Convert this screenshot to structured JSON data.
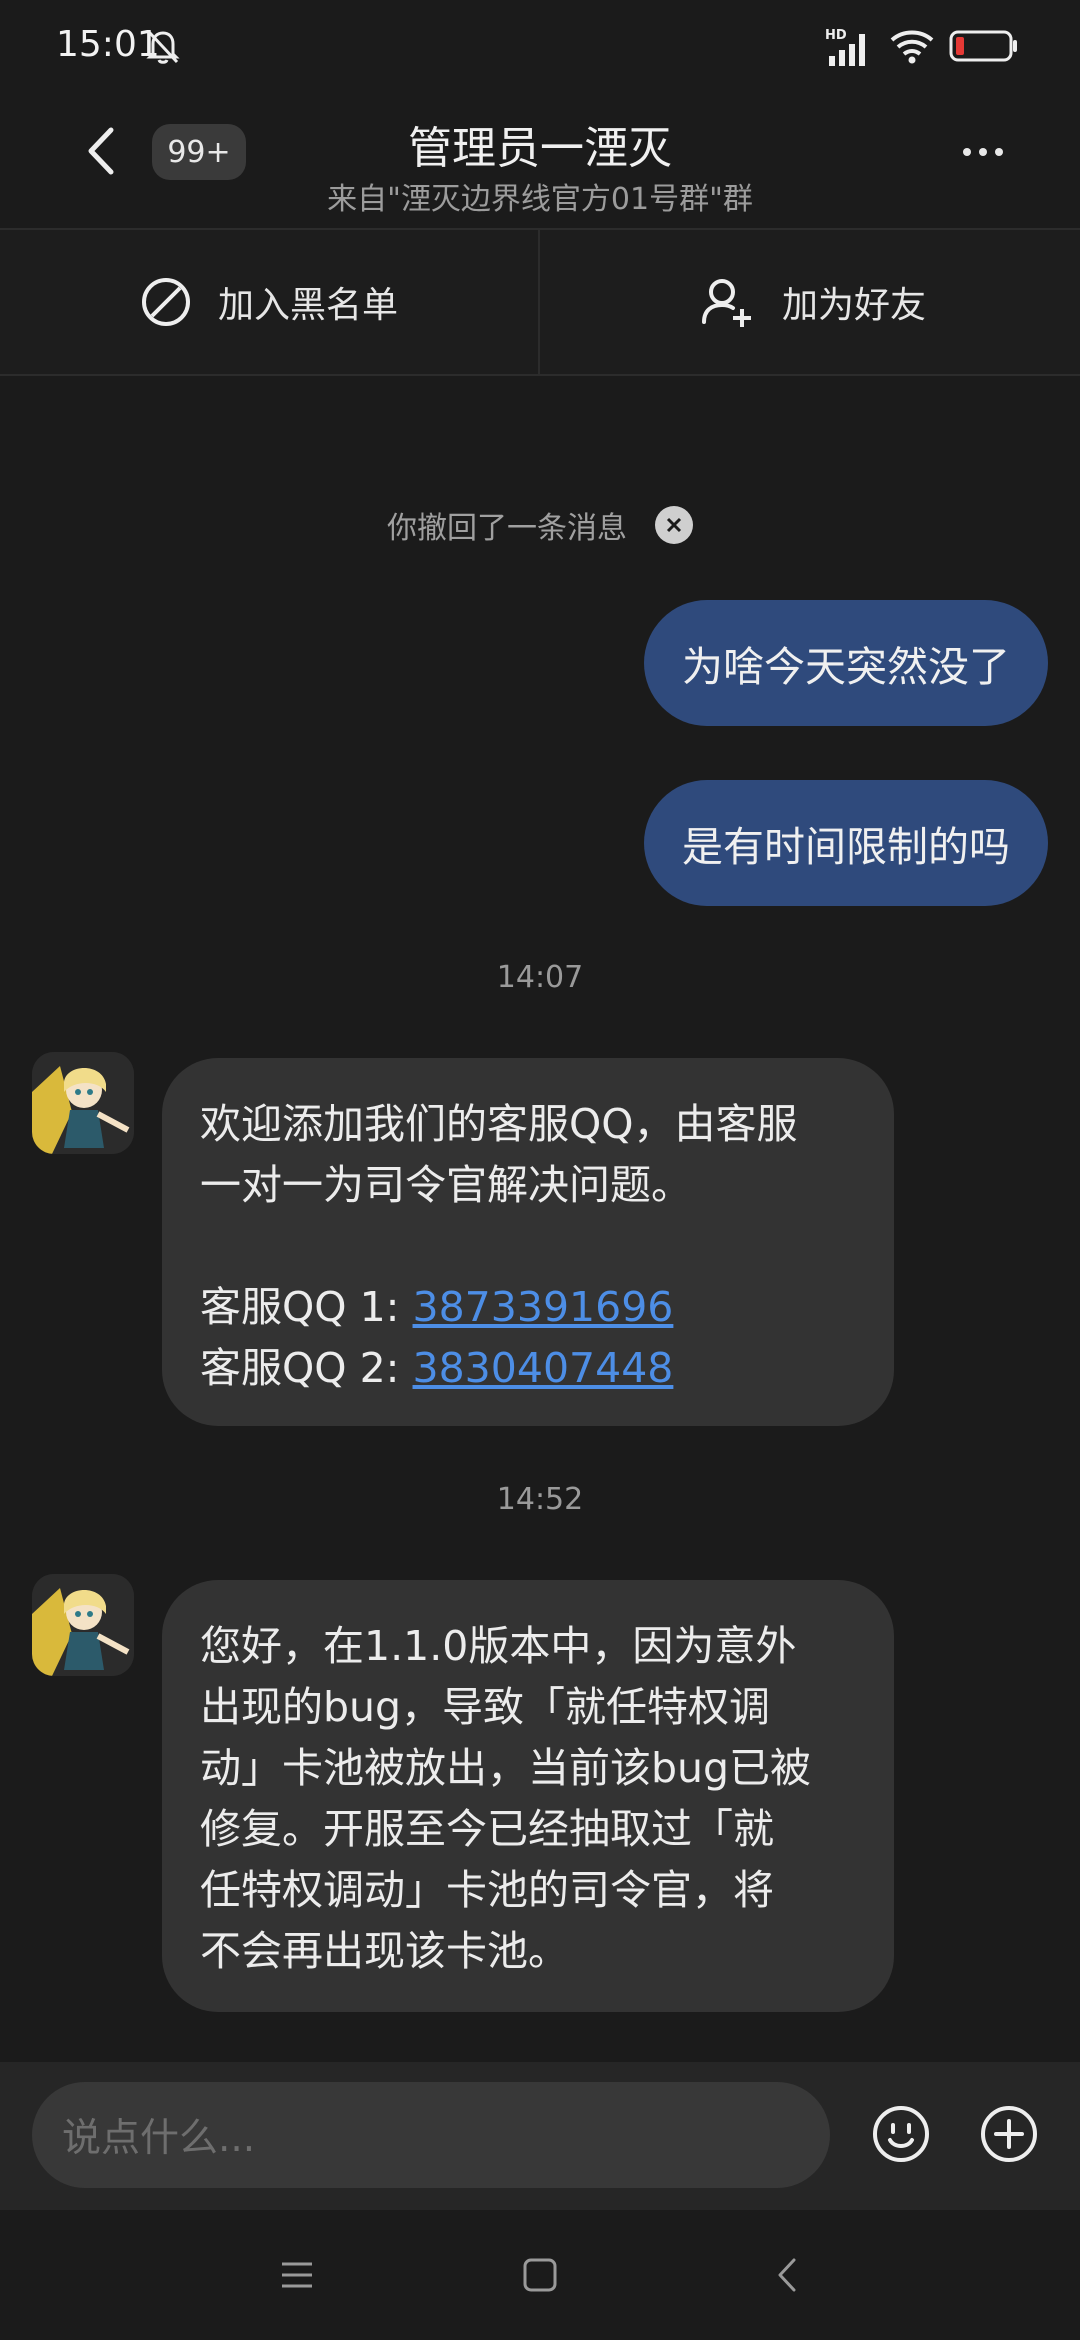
{
  "status_bar": {
    "time": "15:01",
    "network": "HD"
  },
  "header": {
    "unread_count": "99+",
    "title": "管理员一湮灭",
    "subtitle": "来自\"湮灭边界线官方01号群\"群"
  },
  "actions": {
    "block_label": "加入黑名单",
    "add_friend_label": "加为好友"
  },
  "messages": {
    "recalled_notice": "你撤回了一条消息",
    "outgoing": [
      "为啥今天突然没了",
      "是有时间限制的吗"
    ],
    "time_1": "14:07",
    "incoming_1": {
      "line1": "欢迎添加我们的客服QQ，由客服",
      "line2": "一对一为司令官解决问题。",
      "qq1_label": "客服QQ 1: ",
      "qq1_number": "3873391696",
      "qq2_label": "客服QQ 2: ",
      "qq2_number": "3830407448"
    },
    "time_2": "14:52",
    "incoming_2": {
      "lines": [
        "您好，在1.1.0版本中，因为意外",
        "出现的bug，导致「就任特权调",
        "动」卡池被放出，当前该bug已被",
        "修复。开服至今已经抽取过「就",
        "任特权调动」卡池的司令官，将",
        "不会再出现该卡池。"
      ]
    }
  },
  "input": {
    "placeholder": "说点什么..."
  },
  "colors": {
    "background": "#1b1b1b",
    "outgoing_bubble": "#2f4a7c",
    "incoming_bubble": "#333333",
    "link": "#4d8ee6",
    "battery_low": "#e53935"
  },
  "icons": [
    "back-arrow-icon",
    "more-icon",
    "block-icon",
    "add-friend-icon",
    "close-icon",
    "emoji-icon",
    "plus-icon",
    "menu-icon",
    "home-icon",
    "nav-back-icon",
    "bell-off-icon",
    "signal-icon",
    "wifi-icon",
    "battery-icon"
  ]
}
